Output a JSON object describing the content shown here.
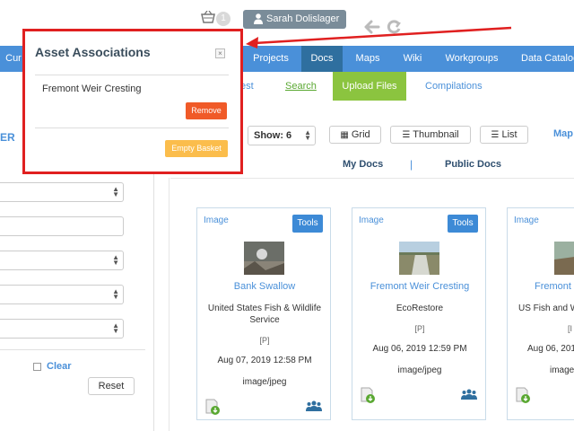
{
  "header": {
    "basket_count": "1",
    "user_name": "Sarah Dolislager"
  },
  "nav": {
    "items": [
      {
        "label": "Cur"
      },
      {
        "label": "Projects"
      },
      {
        "label": "Docs"
      },
      {
        "label": "Maps"
      },
      {
        "label": "Wiki"
      },
      {
        "label": "Workgroups"
      },
      {
        "label": "Data Catalog"
      }
    ]
  },
  "subnav": {
    "items": [
      {
        "label": "est"
      },
      {
        "label": "Search"
      },
      {
        "label": "Upload Files"
      },
      {
        "label": "Compilations"
      }
    ]
  },
  "filters": {
    "section_label": "ER",
    "clear_label": "Clear",
    "reset_label": "Reset"
  },
  "toolbar": {
    "show_label": "Show: 6",
    "grid_label": "Grid",
    "thumbnail_label": "Thumbnail",
    "list_label": "List",
    "map_label": "Map",
    "my_docs": "My Docs",
    "separator": "|",
    "public_docs": "Public Docs"
  },
  "cards": [
    {
      "type": "Image",
      "tools": "Tools",
      "title": "Bank Swallow",
      "agency": "United States Fish & Wildlife Service",
      "badge": "[P]",
      "date": "Aug 07, 2019 12:58 PM",
      "mime": "image/jpeg"
    },
    {
      "type": "Image",
      "tools": "Tools",
      "title": "Fremont Weir Cresting",
      "agency": "EcoRestore",
      "badge": "[P]",
      "date": "Aug 06, 2019 12:59 PM",
      "mime": "image/jpeg"
    },
    {
      "type": "Image",
      "tools": "",
      "title": "Fremont",
      "agency": "US Fish and W",
      "badge": "[I",
      "date": "Aug 06, 2019",
      "mime": "image"
    }
  ],
  "popup": {
    "title": "Asset Associations",
    "close": "×",
    "item": "Fremont Weir Cresting",
    "remove_label": "Remove",
    "empty_label": "Empty Basket"
  },
  "colors": {
    "nav_blue": "#4a90d9",
    "nav_active": "#2f6f9f",
    "upload_green": "#8bc43f",
    "remove_orange": "#f05a28",
    "empty_yellow": "#fbbd4c",
    "highlight_red": "#e02020"
  }
}
